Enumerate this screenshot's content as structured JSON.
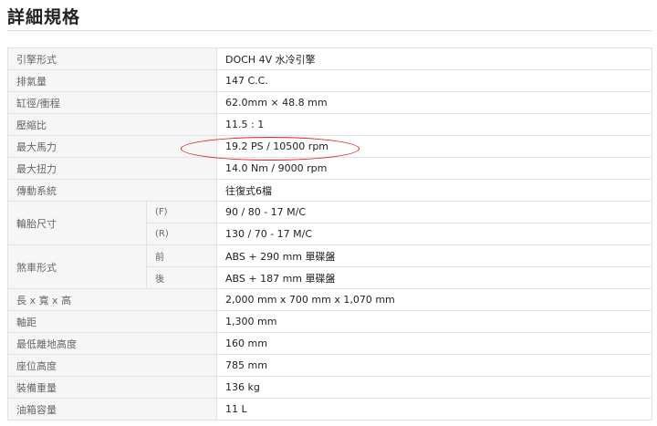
{
  "page": {
    "title": "詳細規格"
  },
  "specs": {
    "engine_type": {
      "label": "引擎形式",
      "value": "DOCH 4V 水冷引擎"
    },
    "displacement": {
      "label": "排氣量",
      "value": "147 C.C."
    },
    "bore_stroke": {
      "label": "缸徑/衝程",
      "value": "62.0mm × 48.8 mm"
    },
    "compression": {
      "label": "壓縮比",
      "value": "11.5 : 1"
    },
    "max_power": {
      "label": "最大馬力",
      "value": "19.2 PS / 10500 rpm"
    },
    "max_torque": {
      "label": "最大扭力",
      "value": "14.0 Nm / 9000 rpm"
    },
    "transmission": {
      "label": "傳動系統",
      "value": "往復式6檔"
    },
    "tire": {
      "label": "輪胎尺寸",
      "front_sub": "(F)",
      "front_value": "90 / 80 - 17 M/C",
      "rear_sub": "(R)",
      "rear_value": "130 / 70 - 17 M/C"
    },
    "brake": {
      "label": "煞車形式",
      "front_sub": "前",
      "front_value": "ABS + 290 mm 單碟盤",
      "rear_sub": "後",
      "rear_value": "ABS + 187 mm 單碟盤"
    },
    "dimensions": {
      "label": "長 x 寬 x 高",
      "value": "2,000 mm x 700 mm x 1,070 mm"
    },
    "wheelbase": {
      "label": "軸距",
      "value": "1,300 mm"
    },
    "ground_clearance": {
      "label": "最低離地高度",
      "value": "160 mm"
    },
    "seat_height": {
      "label": "座位高度",
      "value": "785 mm"
    },
    "curb_weight": {
      "label": "裝備重量",
      "value": "136 kg"
    },
    "fuel_capacity": {
      "label": "油箱容量",
      "value": "11 L"
    }
  },
  "colors": {
    "label_bg": "#f6f6f6",
    "border": "#e2e2e2",
    "highlight": "#e31b1b"
  }
}
